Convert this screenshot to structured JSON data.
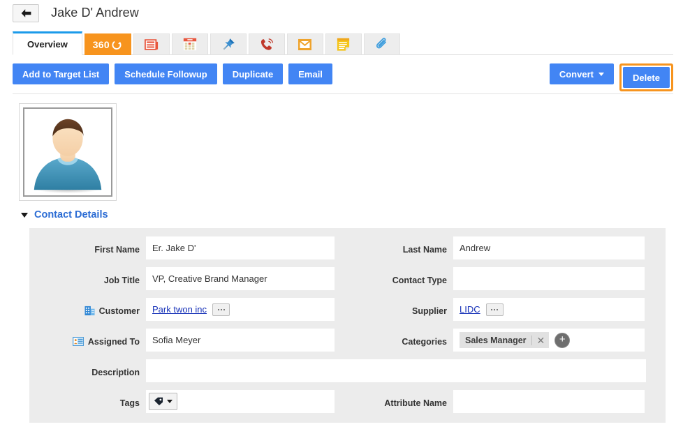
{
  "header": {
    "back_icon": "back-arrow-icon",
    "title": "Jake D' Andrew"
  },
  "tabs": [
    {
      "id": "overview",
      "label": "Overview",
      "type": "text",
      "active": true
    },
    {
      "id": "360",
      "label": "360",
      "type": "text360",
      "active": false
    },
    {
      "id": "news",
      "label": "",
      "icon": "newspaper-icon",
      "type": "icon"
    },
    {
      "id": "calendar",
      "label": "",
      "icon": "calendar-icon",
      "type": "icon"
    },
    {
      "id": "pin",
      "label": "",
      "icon": "pushpin-icon",
      "type": "icon"
    },
    {
      "id": "calls",
      "label": "",
      "icon": "phone-ringing-icon",
      "type": "icon"
    },
    {
      "id": "email",
      "label": "",
      "icon": "envelope-icon",
      "type": "icon"
    },
    {
      "id": "notes",
      "label": "",
      "icon": "sticky-note-icon",
      "type": "icon"
    },
    {
      "id": "attachments",
      "label": "",
      "icon": "paperclip-icon",
      "type": "icon"
    }
  ],
  "toolbar": {
    "add_to_target_list": "Add to Target List",
    "schedule_followup": "Schedule Followup",
    "duplicate": "Duplicate",
    "email": "Email",
    "convert": "Convert",
    "delete": "Delete",
    "highlight_color": "#f7941e",
    "button_color": "#4285f4"
  },
  "avatar": {
    "name": "contact-avatar-placeholder"
  },
  "section": {
    "title": "Contact Details",
    "expanded": true,
    "title_color": "#2b6cd4"
  },
  "form": {
    "first_name": {
      "label": "First Name",
      "value": "Er. Jake D'"
    },
    "last_name": {
      "label": "Last Name",
      "value": "Andrew"
    },
    "job_title": {
      "label": "Job Title",
      "value": "VP, Creative Brand Manager"
    },
    "contact_type": {
      "label": "Contact Type",
      "value": ""
    },
    "customer": {
      "label": "Customer",
      "value": "Park twon inc",
      "icon": "building-icon",
      "is_link": true,
      "picker": "..."
    },
    "supplier": {
      "label": "Supplier",
      "value": "LIDC",
      "is_link": true,
      "picker": "..."
    },
    "assigned_to": {
      "label": "Assigned To",
      "value": "Sofia Meyer",
      "icon": "contact-card-icon"
    },
    "categories": {
      "label": "Categories",
      "chips": [
        "Sales Manager"
      ],
      "remove_label": "✕",
      "add_label": "+"
    },
    "description": {
      "label": "Description",
      "value": ""
    },
    "tags": {
      "label": "Tags",
      "value": "",
      "icon": "tag-icon"
    },
    "attribute_name": {
      "label": "Attribute Name",
      "value": ""
    }
  }
}
